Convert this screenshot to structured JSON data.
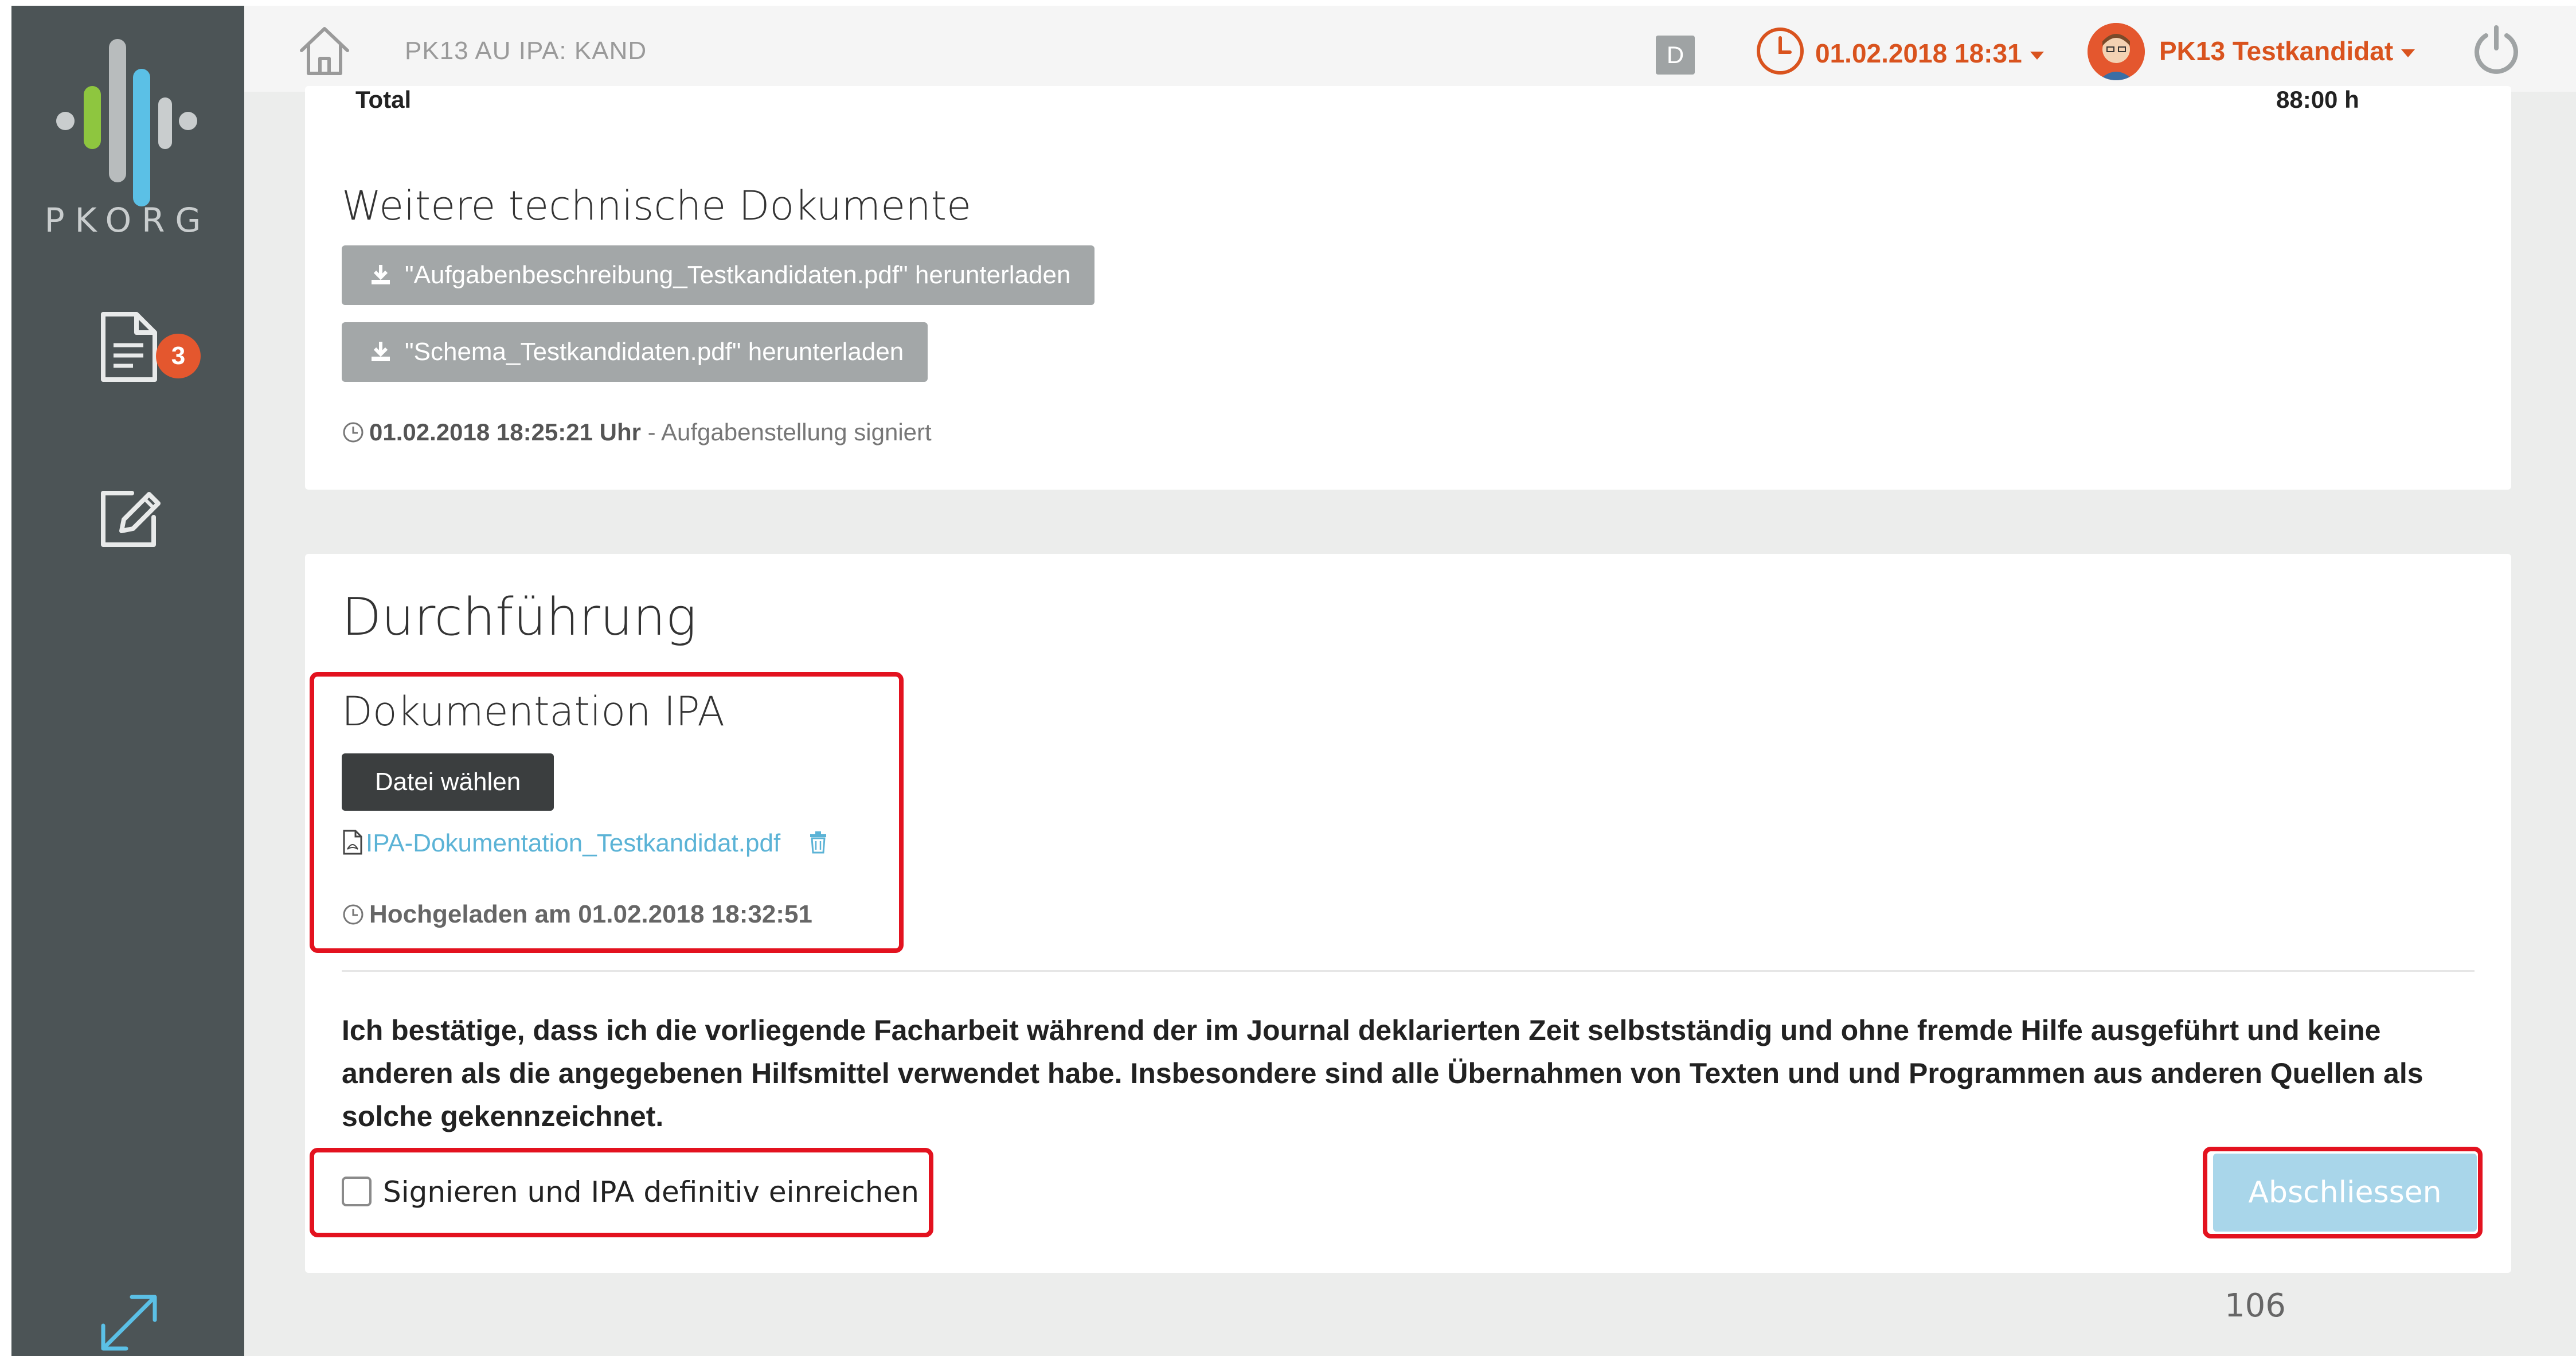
{
  "sidebar": {
    "logo_text": "PKORG",
    "documents_badge": "3"
  },
  "header": {
    "breadcrumb": "PK13 AU IPA: KAND",
    "mode_badge": "D",
    "datetime": "01.02.2018 18:31",
    "user": "PK13 Testkandidat"
  },
  "summary": {
    "total_label": "Total",
    "total_value": "88:00 h"
  },
  "tech_docs": {
    "title": "Weitere technische Dokumente",
    "downloads": [
      "\"Aufgabenbeschreibung_Testkandidaten.pdf\" herunterladen",
      "\"Schema_Testkandidaten.pdf\" herunterladen"
    ],
    "signed_time": "01.02.2018 18:25:21 Uhr",
    "signed_text": " - Aufgabenstellung signiert"
  },
  "execution": {
    "title": "Durchführung",
    "doc_title": "Dokumentation IPA",
    "choose_file": "Datei wählen",
    "file_name": "IPA-Dokumentation_Testkandidat.pdf",
    "uploaded": "Hochgeladen am 01.02.2018 18:32:51",
    "confirm_text": "Ich bestätige, dass ich die vorliegende Facharbeit während der im Journal deklarierten Zeit selbstständig und ohne fremde Hilfe ausgeführt und keine anderen als die angegebenen Hilfsmittel verwendet habe. Insbesondere sind alle Übernahmen von Texten und und Programmen aus anderen Quellen als solche gekennzeichnet.",
    "checkbox_label": "Signieren und IPA definitiv einreichen",
    "submit_label": "Abschliessen"
  },
  "page_number": "106",
  "colors": {
    "accent": "#d9531e",
    "link": "#5bb3d6",
    "highlight": "#e3121f",
    "sidebar": "#4c5456"
  }
}
